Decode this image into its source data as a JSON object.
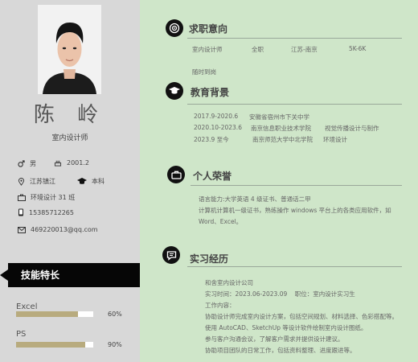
{
  "profile": {
    "name": "陈 岭",
    "job_title": "室内设计师",
    "gender": "男",
    "birth": "2001.2",
    "location": "江苏镇江",
    "degree": "本科",
    "class": "环境设计 31 班",
    "phone": "15385712265",
    "email": "469220013@qq.com"
  },
  "skills": {
    "title": "技能特长",
    "items": [
      {
        "name": "Excel",
        "percent_label": "60%",
        "level": 0.8
      },
      {
        "name": "PS",
        "percent_label": "90%",
        "level": 0.9
      }
    ]
  },
  "job_intent": {
    "title": "求职意向",
    "position": "室内设计师",
    "type": "全职",
    "city": "江苏-南京",
    "salary": "5K-6K",
    "availability": "随时到岗"
  },
  "education": {
    "title": "教育背景",
    "rows": [
      {
        "period": "2017.9-2020.6",
        "school": "安徽省宿州市下关中学",
        "major": ""
      },
      {
        "period": "2020.10-2023.6",
        "school": "南京信息职业技术学院",
        "major": "视觉传播设计与制作"
      },
      {
        "period": "2023.9 至今",
        "school": "南京师范大学中北学院",
        "major": "环境设计"
      }
    ]
  },
  "honors": {
    "title": "个人荣誉",
    "lines": [
      "语言能力:大学英语 4 级证书、普通话二甲",
      "计算机计算机一级证书，熟练操作 windows 平台上的各类应用软件，如",
      "Word、Excel。"
    ]
  },
  "internship": {
    "title": "实习经历",
    "company": "和舍室内设计公司",
    "time_label": "实习时间：",
    "time": "2023.06-2023.09",
    "role_label": "职位：",
    "role": "室内设计实习生",
    "content_label": "工作内容：",
    "duties": [
      "协助设计师完成室内设计方案，包括空间规划、材料选择、色彩搭配等。",
      "使用 AutoCAD、SketchUp 等设计软件绘制室内设计图纸。",
      "参与客户沟通会议，了解客户需求并提供设计建议。",
      "协助项目团队的日常工作，包括资料整理、进度跟进等。"
    ]
  }
}
